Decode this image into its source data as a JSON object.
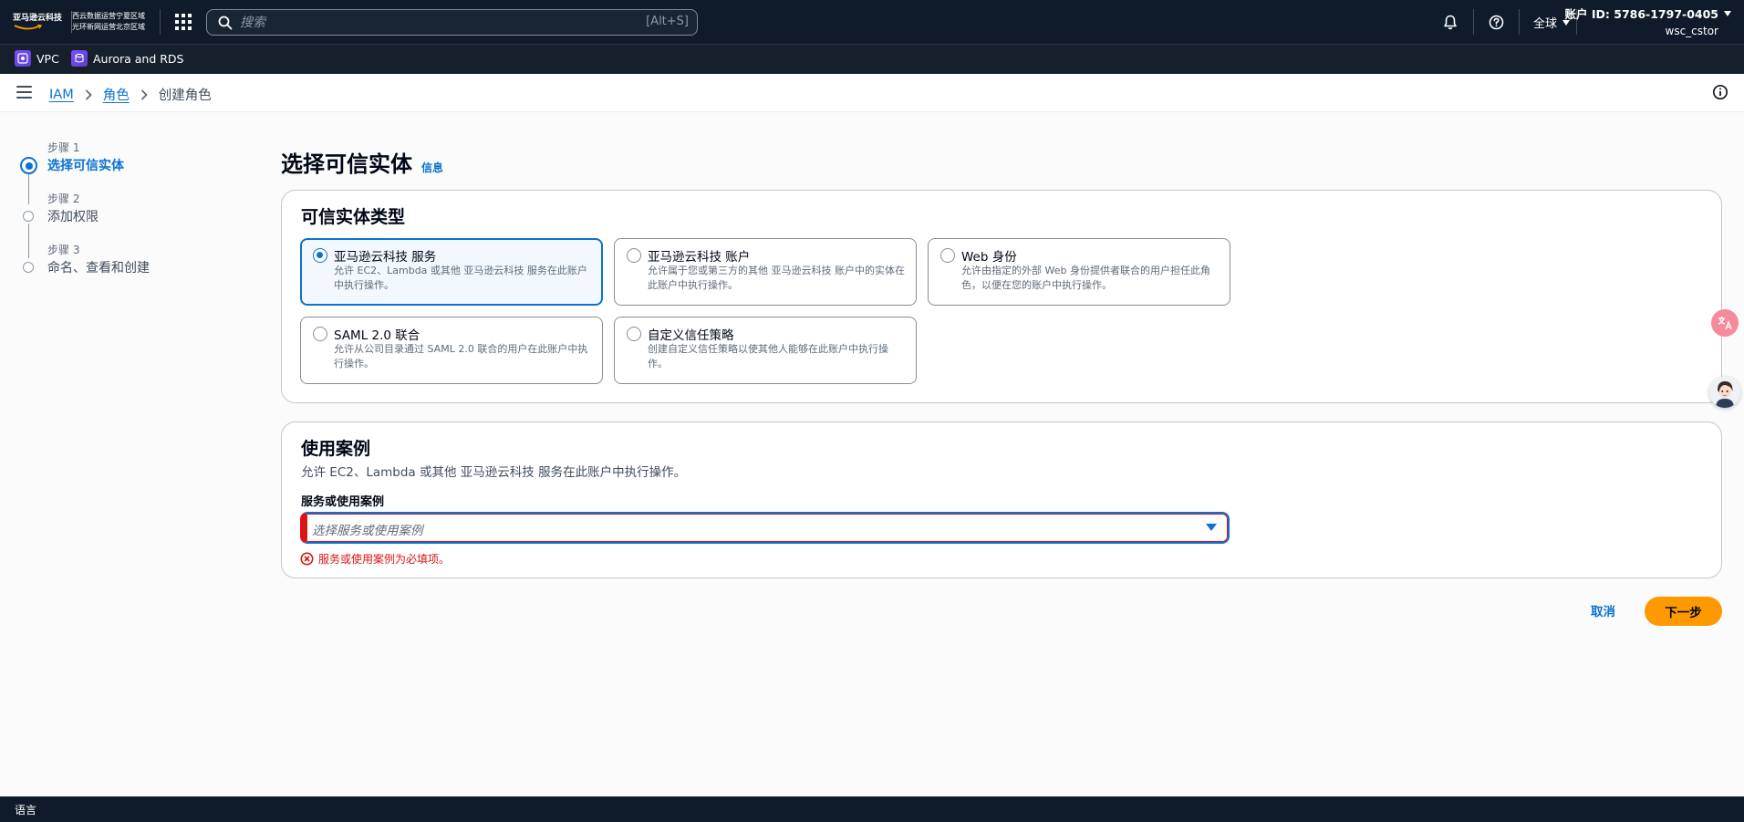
{
  "topnav": {
    "brand": "亚马逊云科技",
    "region_line1": "西云数据运营宁夏区域",
    "region_line2": "光环新网运营北京区域",
    "search_placeholder": "搜索",
    "search_shortcut": "[Alt+S]",
    "region_label": "全球",
    "account_id": "账户 ID: 5786-1797-0405",
    "account_user": "wsc_cstor"
  },
  "favorites": [
    {
      "label": "VPC",
      "icon": "vpc-icon"
    },
    {
      "label": "Aurora and RDS",
      "icon": "rds-icon"
    }
  ],
  "breadcrumb": {
    "items": [
      "IAM",
      "角色"
    ],
    "current": "创建角色"
  },
  "steps": [
    {
      "num": "步骤 1",
      "title": "选择可信实体",
      "active": true
    },
    {
      "num": "步骤 2",
      "title": "添加权限",
      "active": false
    },
    {
      "num": "步骤 3",
      "title": "命名、查看和创建",
      "active": false
    }
  ],
  "page": {
    "title": "选择可信实体",
    "info_link": "信息"
  },
  "trusted_entity": {
    "title": "可信实体类型",
    "options": [
      {
        "label": "亚马逊云科技 服务",
        "desc": "允许 EC2、Lambda 或其他 亚马逊云科技 服务在此账户中执行操作。",
        "selected": true
      },
      {
        "label": "亚马逊云科技 账户",
        "desc": "允许属于您或第三方的其他 亚马逊云科技 账户中的实体在此账户中执行操作。",
        "selected": false
      },
      {
        "label": "Web 身份",
        "desc": "允许由指定的外部 Web 身份提供者联合的用户担任此角色，以便在您的账户中执行操作。",
        "selected": false
      },
      {
        "label": "SAML 2.0 联合",
        "desc": "允许从公司目录通过 SAML 2.0 联合的用户在此账户中执行操作。",
        "selected": false
      },
      {
        "label": "自定义信任策略",
        "desc": "创建自定义信任策略以使其他人能够在此账户中执行操作。",
        "selected": false
      }
    ]
  },
  "use_case": {
    "title": "使用案例",
    "desc": "允许 EC2、Lambda 或其他 亚马逊云科技 服务在此账户中执行操作。",
    "field_label": "服务或使用案例",
    "select_placeholder": "选择服务或使用案例",
    "error": "服务或使用案例为必填项。"
  },
  "actions": {
    "cancel": "取消",
    "next": "下一步"
  },
  "footer": {
    "language": "语言"
  },
  "colors": {
    "nav_bg": "#0f1b2a",
    "link": "#0972d3",
    "primary_button": "#ff9900",
    "error": "#d91515"
  }
}
